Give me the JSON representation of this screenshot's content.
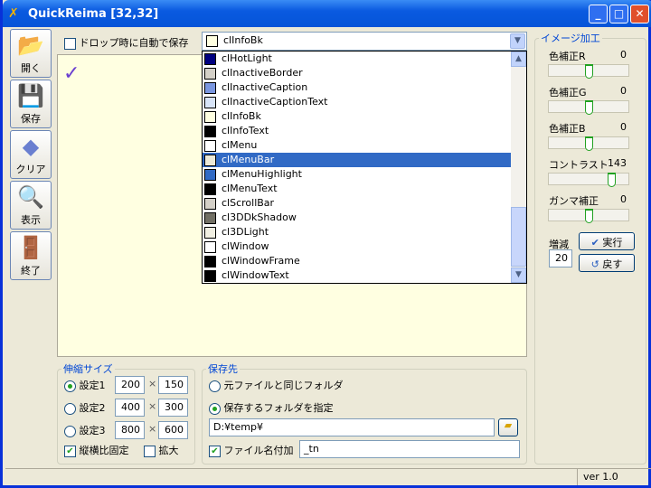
{
  "window": {
    "title": "QuickReima [32,32]"
  },
  "toolbar": [
    {
      "label": "開く",
      "icon": "folder-open-icon"
    },
    {
      "label": "保存",
      "icon": "floppy-disk-icon"
    },
    {
      "label": "クリア",
      "icon": "eraser-icon"
    },
    {
      "label": "表示",
      "icon": "magnifier-icon"
    },
    {
      "label": "終了",
      "icon": "exit-door-icon"
    }
  ],
  "auto_save": {
    "label": "ドロップ時に自動で保存",
    "checked": false
  },
  "color_combo": {
    "value": "clInfoBk",
    "swatch": "#ffffe1"
  },
  "color_list": [
    {
      "name": "clHotLight",
      "color": "#000080"
    },
    {
      "name": "clInactiveBorder",
      "color": "#d4d0c8"
    },
    {
      "name": "clInactiveCaption",
      "color": "#7a96df"
    },
    {
      "name": "clInactiveCaptionText",
      "color": "#d8e4f8"
    },
    {
      "name": "clInfoBk",
      "color": "#ffffe1"
    },
    {
      "name": "clInfoText",
      "color": "#000000"
    },
    {
      "name": "clMenu",
      "color": "#ffffff"
    },
    {
      "name": "clMenuBar",
      "color": "#ece9d8",
      "selected": true
    },
    {
      "name": "clMenuHighlight",
      "color": "#316ac5"
    },
    {
      "name": "clMenuText",
      "color": "#000000"
    },
    {
      "name": "clScrollBar",
      "color": "#d4d0c8"
    },
    {
      "name": "cl3DDkShadow",
      "color": "#716f64"
    },
    {
      "name": "cl3DLight",
      "color": "#f1efe2"
    },
    {
      "name": "clWindow",
      "color": "#ffffff"
    },
    {
      "name": "clWindowFrame",
      "color": "#000000"
    },
    {
      "name": "clWindowText",
      "color": "#000000"
    }
  ],
  "image_adjust": {
    "title": "イメージ加工",
    "sliders": [
      {
        "label": "色補正R",
        "value": "0",
        "pos": 0.5
      },
      {
        "label": "色補正G",
        "value": "0",
        "pos": 0.5
      },
      {
        "label": "色補正B",
        "value": "0",
        "pos": 0.5
      },
      {
        "label": "コントラスト",
        "value": "143",
        "pos": 0.78
      },
      {
        "label": "ガンマ補正",
        "value": "0",
        "pos": 0.5
      }
    ],
    "step_label": "増減",
    "step_value": "20",
    "run_label": "実行",
    "undo_label": "戻す"
  },
  "resize": {
    "title": "伸縮サイズ",
    "presets": [
      {
        "label": "設定1",
        "w": "200",
        "h": "150",
        "selected": true
      },
      {
        "label": "設定2",
        "w": "400",
        "h": "300",
        "selected": false
      },
      {
        "label": "設定3",
        "w": "800",
        "h": "600",
        "selected": false
      }
    ],
    "times": "×",
    "keep_ratio": "縦横比固定",
    "enlarge": "拡大"
  },
  "save_to": {
    "title": "保存先",
    "same_folder": "元ファイルと同じフォルダ",
    "specify_folder": "保存するフォルダを指定",
    "folder": "D:¥temp¥",
    "suffix_label": "ファイル名付加",
    "suffix": "_tn"
  },
  "status": {
    "version": "ver 1.0"
  }
}
